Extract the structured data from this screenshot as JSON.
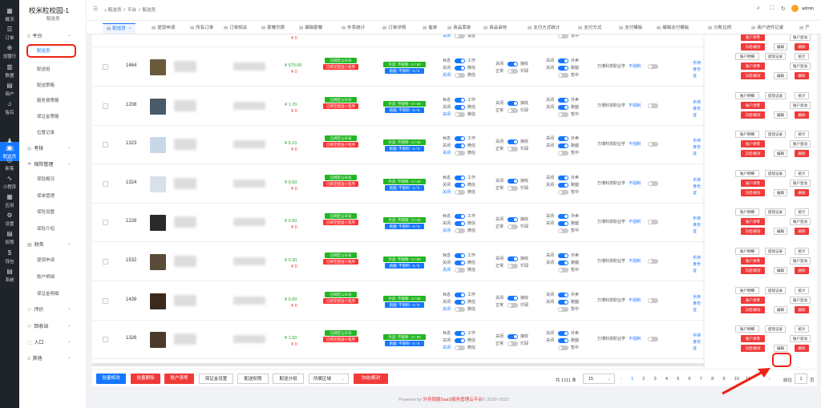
{
  "school": {
    "name": "校米粒校园-1",
    "role": "配送员"
  },
  "nav": [
    "概况",
    "订单",
    "加盟行",
    "数据",
    "商户",
    "售后",
    "配送员",
    "店员",
    "新客",
    "小程序",
    "应用",
    "设置",
    "权限",
    "钱包",
    "系统"
  ],
  "menu": {
    "g1": "平台",
    "i1": [
      "配送员",
      "配送组",
      "配送策略",
      "服务费策略",
      "保证金策略",
      "位置记录"
    ],
    "g2": "考核",
    "g3": "保险管理",
    "i3": [
      "保险概况",
      "保单管理",
      "保险设置",
      "保险介绍"
    ],
    "g4": "财务",
    "i4": [
      "提现申请",
      "账户明细",
      "保证金明细"
    ],
    "g5": "评价",
    "g6": "回收站",
    "g7": "入口",
    "g8": "其他"
  },
  "top": {
    "crumb1": "配送员",
    "crumb2": "平台",
    "crumb3": "配送员",
    "user": "admin"
  },
  "tabs": [
    "配送员",
    "提现申请",
    "所有订单",
    "订单相关",
    "套餐列表",
    "编辑套餐",
    "外卖统计",
    "订单详情",
    "催单",
    "商品菜单",
    "商品审核",
    "支付方式统计",
    "支付方式",
    "支付模板",
    "编辑支付模板",
    "分账比例",
    "商户进件记录",
    "产"
  ],
  "rows": [
    {
      "id": "",
      "m1": "",
      "m2": "¥ 0",
      "b1": "已绑定公众号",
      "b2": "已绑定配送小程序",
      "b3": "外卖: 不限制 - 0 / 50",
      "b4": "跑腿: 不限制 - 0 / 5",
      "s1": "休息",
      "s1b": "工作",
      "s2": "关闭",
      "s2b": "语音",
      "s3": "关闭",
      "s3b": "接收",
      "s4": "正常",
      "s4b": "忙碌",
      "s5": "关闭",
      "s5b": "外卖",
      "s6": "关闭",
      "s6b": "跑腿",
      "s7": "暂中",
      "school": "",
      "force": "",
      "auth": ""
    },
    {
      "id": "1464",
      "m1": "¥ 575.00",
      "m2": "¥ 0",
      "b1": "已绑定公众号",
      "b2": "已绑定配送小程序",
      "b3": "外卖: 不限制 - 0 / 50",
      "b4": "跑腿: 不限制 - 0 / 5",
      "s1": "休息",
      "s1b": "工作",
      "s2": "关闭",
      "s2b": "微信",
      "s3": "关闭",
      "s3b": "接收",
      "s4": "正常",
      "s4b": "忙碌",
      "s5": "关闭",
      "s5b": "外卖",
      "s6": "关闭",
      "s6b": "跑腿",
      "s7": "暂中",
      "school": "万博科技职业学",
      "force": "不强制",
      "auth": "手持身份证"
    },
    {
      "id": "1208",
      "m1": "¥ 1.70",
      "m2": "¥ 0",
      "b1": "已绑定公众号",
      "b2": "已绑定配送小程序",
      "b3": "外卖: 不限制 - 0 / 50",
      "b4": "跑腿: 不限制 - 0 / 5",
      "s1": "休息",
      "s1b": "工作",
      "s2": "关闭",
      "s2b": "微信",
      "s3": "关闭",
      "s3b": "接收",
      "s4": "正常",
      "s4b": "忙碌",
      "s5": "关闭",
      "s5b": "外卖",
      "s6": "关闭",
      "s6b": "跑腿",
      "s7": "暂中",
      "school": "万博科技职业学",
      "force": "不强制",
      "auth": "手持身份证"
    },
    {
      "id": "1323",
      "m1": "¥ 5.10",
      "m2": "¥ 0",
      "b1": "已绑定公众号",
      "b2": "已绑定配送小程序",
      "b3": "外卖: 不限制 - 0 / 50",
      "b4": "跑腿: 不限制 - 0 / 5",
      "s1": "休息",
      "s1b": "工作",
      "s2": "关闭",
      "s2b": "微信",
      "s3": "关闭",
      "s3b": "接收",
      "s4": "正常",
      "s4b": "忙碌",
      "s5": "关闭",
      "s5b": "外卖",
      "s6": "关闭",
      "s6b": "跑腿",
      "s7": "暂中",
      "school": "万博科技职业学",
      "force": "不强制",
      "auth": "手持身份证"
    },
    {
      "id": "1324",
      "m1": "¥ 0.00",
      "m2": "¥ 0",
      "b1": "已绑定公众号",
      "b2": "已绑定配送小程序",
      "b3": "外卖: 不限制 - 0 / 50",
      "b4": "跑腿: 不限制 - 0 / 5",
      "s1": "休息",
      "s1b": "工作",
      "s2": "关闭",
      "s2b": "微信",
      "s3": "关闭",
      "s3b": "接收",
      "s4": "正常",
      "s4b": "忙碌",
      "s5": "关闭",
      "s5b": "外卖",
      "s6": "关闭",
      "s6b": "跑腿",
      "s7": "暂中",
      "school": "万博科技职业学",
      "force": "不强制",
      "auth": "手持身份证"
    },
    {
      "id": "1228",
      "m1": "¥ 0.00",
      "m2": "¥ 0",
      "b1": "已绑定公众号",
      "b2": "已绑定配送小程序",
      "b3": "外卖: 不限制 - 0 / 50",
      "b4": "跑腿: 不限制 - 0 / 5",
      "s1": "休息",
      "s1b": "工作",
      "s2": "关闭",
      "s2b": "微信",
      "s3": "关闭",
      "s3b": "接收",
      "s4": "正常",
      "s4b": "忙碌",
      "s5": "关闭",
      "s5b": "外卖",
      "s6": "关闭",
      "s6b": "跑腿",
      "s7": "暂中",
      "school": "万博科技职业学",
      "force": "不强制",
      "auth": "手持身份证"
    },
    {
      "id": "1532",
      "m1": "¥ 0.30",
      "m2": "¥ 0",
      "b1": "已绑定公众号",
      "b2": "已绑定配送小程序",
      "b3": "外卖: 不限制 - 0 / 50",
      "b4": "跑腿: 不限制 - 0 / 5",
      "s1": "休息",
      "s1b": "工作",
      "s2": "关闭",
      "s2b": "微信",
      "s3": "关闭",
      "s3b": "接收",
      "s4": "正常",
      "s4b": "忙碌",
      "s5": "关闭",
      "s5b": "外卖",
      "s6": "关闭",
      "s6b": "跑腿",
      "s7": "暂中",
      "school": "万博科技职业学",
      "force": "不强制",
      "auth": "手持身份证"
    },
    {
      "id": "1439",
      "m1": "¥ 0.00",
      "m2": "¥ 0",
      "b1": "已绑定公众号",
      "b2": "已绑定配送小程序",
      "b3": "外卖: 不限制 - 0 / 50",
      "b4": "跑腿: 不限制 - 0 / 5",
      "s1": "休息",
      "s1b": "工作",
      "s2": "关闭",
      "s2b": "微信",
      "s3": "关闭",
      "s3b": "接收",
      "s4": "正常",
      "s4b": "忙碌",
      "s5": "关闭",
      "s5b": "外卖",
      "s6": "关闭",
      "s6b": "跑腿",
      "s7": "暂中",
      "school": "万博科技职业学",
      "force": "不强制",
      "auth": "手持身份证"
    },
    {
      "id": "1326",
      "m1": "¥ 1.50",
      "m2": "¥ 0",
      "b1": "已绑定公众号",
      "b2": "已绑定配送小程序",
      "b3": "外卖: 不限制 - 0 / 50",
      "b4": "跑腿: 不限制 - 0 / 5",
      "s1": "休息",
      "s1b": "工作",
      "s2": "关闭",
      "s2b": "微信",
      "s3": "关闭",
      "s3b": "接收",
      "s4": "正常",
      "s4b": "忙碌",
      "s5": "关闭",
      "s5b": "外卖",
      "s6": "关闭",
      "s6b": "跑腿",
      "s7": "暂中",
      "school": "万博科技职业学",
      "force": "不强制",
      "auth": "手持身份证"
    }
  ],
  "actions": {
    "a1": "账户明细",
    "a2": "提现记录",
    "a3": "统计",
    "a4": "账户清零",
    "a5": "账户变动",
    "a6": "冻结/解封",
    "a7": "编辑",
    "a8": "删除"
  },
  "footer": {
    "bulk_edit": "批量修改",
    "bulk_delete": "批量删除",
    "clear_account": "账户清零",
    "deposit": "保证金设置",
    "perm": "配送权限",
    "group": "配送分组",
    "area": "所属区域",
    "freeze": "冻结/解封",
    "total": "共 1211 条",
    "page_size": "15",
    "pages": [
      "1",
      "2",
      "3",
      "4",
      "5",
      "6",
      "7",
      "8",
      "9",
      "10",
      "11"
    ],
    "goto": "前往",
    "page": "1",
    "page_unit": "页"
  },
  "copyright": {
    "pre": "Powered by ",
    "brand": "外卖跑腿SaaS服务管理云平台",
    "post": "© 2020~2022"
  }
}
